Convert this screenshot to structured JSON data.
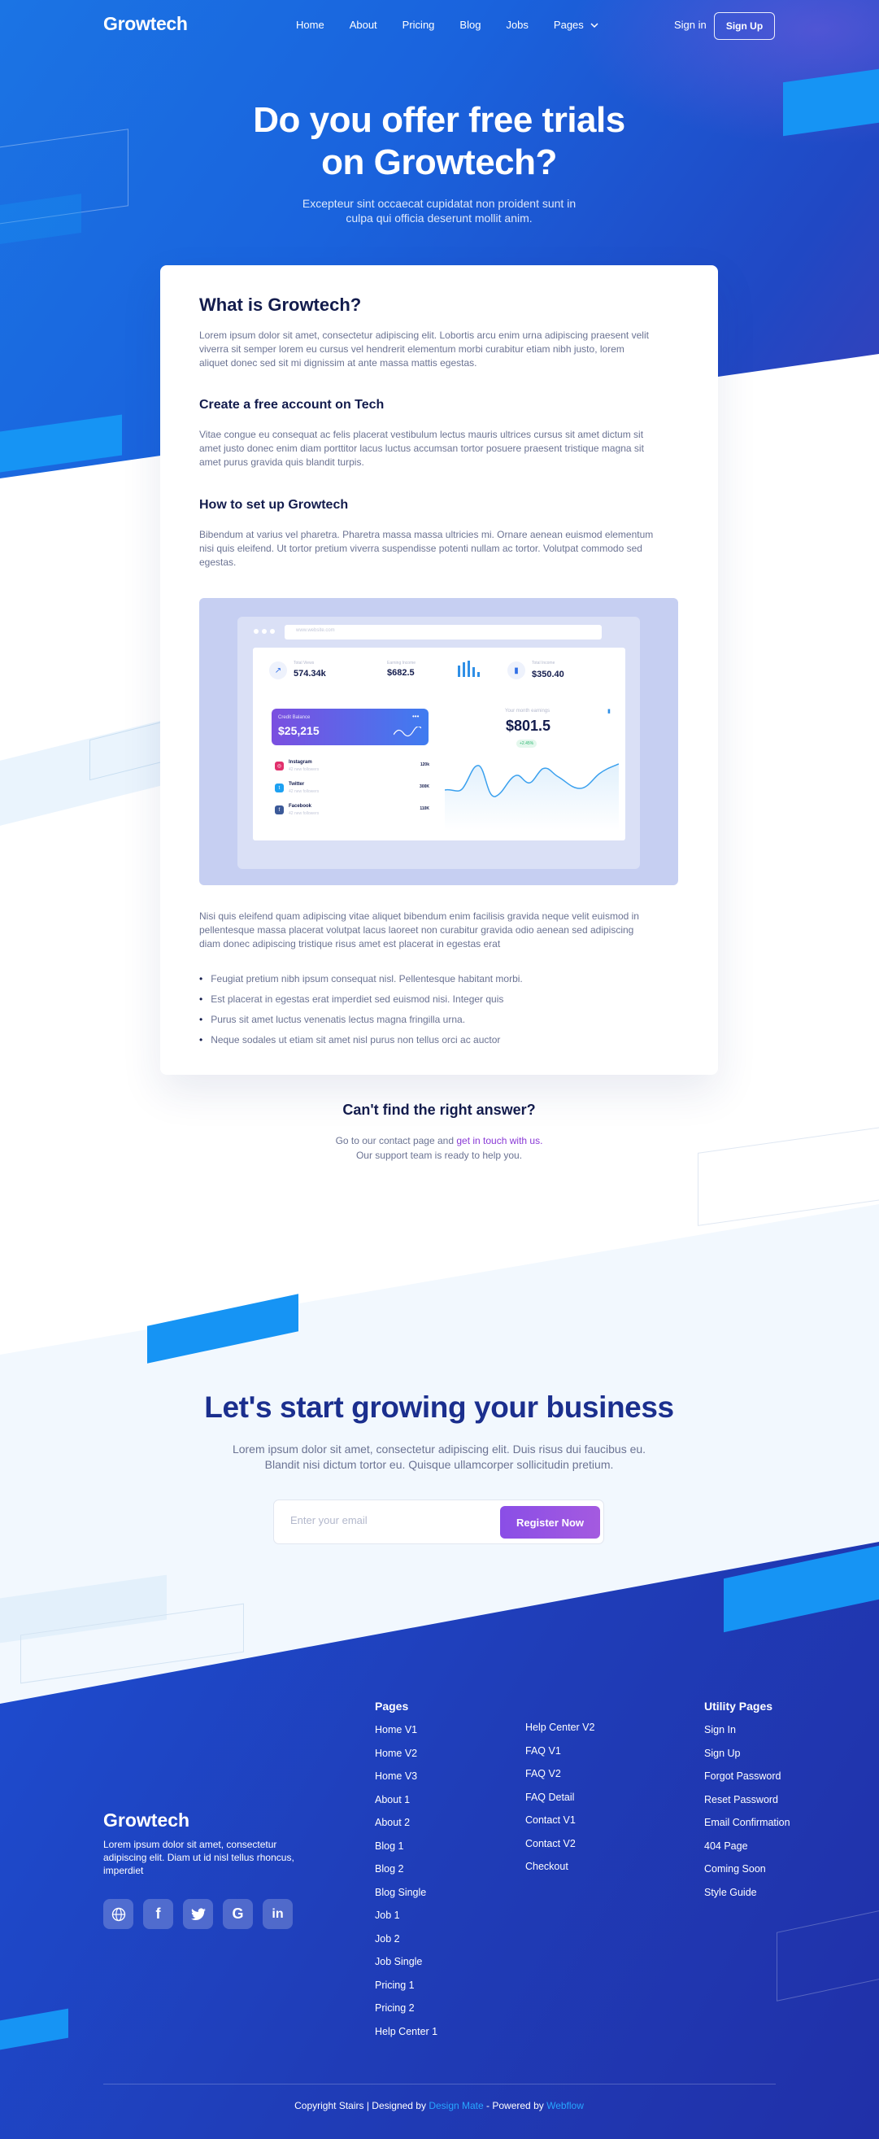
{
  "nav": {
    "logo": "Growtech",
    "links": [
      "Home",
      "About",
      "Pricing",
      "Blog",
      "Jobs",
      "Pages"
    ],
    "signin": "Sign in",
    "signup": "Sign Up"
  },
  "hero": {
    "title_line1": "Do you offer free trials",
    "title_line2": "on Growtech?",
    "subtitle_line1": "Excepteur sint occaecat cupidatat non proident sunt in",
    "subtitle_line2": "culpa qui officia deserunt mollit anim."
  },
  "article": {
    "h1": "What is Growtech?",
    "p1": "Lorem ipsum dolor sit amet, consectetur adipiscing elit. Lobortis arcu enim urna adipiscing praesent velit viverra sit semper lorem eu cursus vel hendrerit elementum morbi curabitur etiam nibh justo, lorem aliquet donec sed sit mi dignissim at ante massa mattis egestas.",
    "h2": "Create a free account on Tech",
    "p2": "Vitae congue eu consequat ac felis placerat vestibulum lectus mauris ultrices cursus sit amet dictum sit amet justo donec enim diam porttitor lacus luctus accumsan tortor posuere praesent tristique magna sit amet purus gravida quis blandit turpis.",
    "h3": "How to set up Growtech",
    "p3": "Bibendum at varius vel pharetra. Pharetra massa massa ultricies mi. Ornare aenean euismod elementum nisi quis eleifend. Ut tortor pretium viverra suspendisse potenti nullam ac tortor. Volutpat commodo sed egestas.",
    "p4": "Nisi quis eleifend quam adipiscing vitae aliquet bibendum enim facilisis gravida neque velit euismod in pellentesque massa placerat volutpat lacus laoreet non curabitur gravida odio aenean sed adipiscing diam donec adipiscing tristique risus amet est placerat in egestas erat",
    "bullets": [
      "Feugiat pretium nibh ipsum consequat nisl. Pellentesque habitant morbi.",
      "Est placerat in egestas erat imperdiet sed euismod nisi. Integer quis",
      "Purus sit amet luctus venenatis lectus magna fringilla urna.",
      "Neque sodales ut etiam sit amet nisl purus non tellus orci ac auctor"
    ]
  },
  "dashboard": {
    "url_text": "www.website.com",
    "stats": [
      {
        "label": "Total Views",
        "value": "574.34k"
      },
      {
        "label": "Earning Income",
        "value": "$682.5"
      },
      {
        "label": "",
        "value": ""
      },
      {
        "label": "Total Income",
        "value": "$350.40"
      }
    ],
    "credit_label": "Credit Balance",
    "credit_value": "$25,215",
    "socials": [
      {
        "name": "Instagram",
        "sub": "42 new followers",
        "value": "120k"
      },
      {
        "name": "Twitter",
        "sub": "42 new followers",
        "value": "300K"
      },
      {
        "name": "Facebook",
        "sub": "42 new followers",
        "value": "110K"
      }
    ],
    "earnings_label": "Your month earnings",
    "earnings_value": "$801.5",
    "earnings_badge": "+2.45%",
    "colors": {
      "instagram": "#e1306c",
      "twitter": "#1da1f2",
      "facebook": "#3b5998",
      "line": "#3aa0ee"
    }
  },
  "help": {
    "title": "Can't find the right answer?",
    "line1_pre": "Go to our contact page and ",
    "line1_link": "get in touch with us.",
    "line2": "Our support team is ready to help you."
  },
  "cta": {
    "title": "Let's start growing your business",
    "sub_line1": "Lorem ipsum dolor sit amet, consectetur adipiscing elit. Duis risus dui faucibus eu.",
    "sub_line2": "Blandit nisi dictum tortor eu. Quisque ullamcorper sollicitudin pretium.",
    "email_placeholder": "Enter your email",
    "button": "Register Now"
  },
  "footer": {
    "logo": "Growtech",
    "description": "Lorem ipsum dolor sit amet, consectetur adipiscing elit. Diam ut id nisl tellus rhoncus, imperdiet",
    "social_icons": [
      "globe-icon",
      "facebook-icon",
      "twitter-icon",
      "google-icon",
      "linkedin-icon"
    ],
    "pages_title": "Pages",
    "pages_col1": [
      "Home V1",
      "Home V2",
      "Home V3",
      "About 1",
      "About 2",
      "Blog 1",
      "Blog 2",
      "Blog Single",
      "Job 1",
      "Job 2",
      "Job Single",
      "Pricing 1",
      "Pricing 2",
      "Help Center 1"
    ],
    "pages_col2": [
      "Help Center V2",
      "FAQ V1",
      "FAQ V2",
      "FAQ Detail",
      "Contact V1",
      "Contact V2",
      "Checkout"
    ],
    "utility_title": "Utility Pages",
    "utility": [
      "Sign In",
      "Sign Up",
      "Forgot Password",
      "Reset Password",
      "Email Confirmation",
      "404 Page",
      "Coming Soon",
      "Style Guide"
    ],
    "copyright_pre": "Copyright Stairs | Designed by ",
    "copyright_designer": "Design Mate",
    "copyright_mid": " - Powered by ",
    "copyright_platform": "Webflow"
  }
}
